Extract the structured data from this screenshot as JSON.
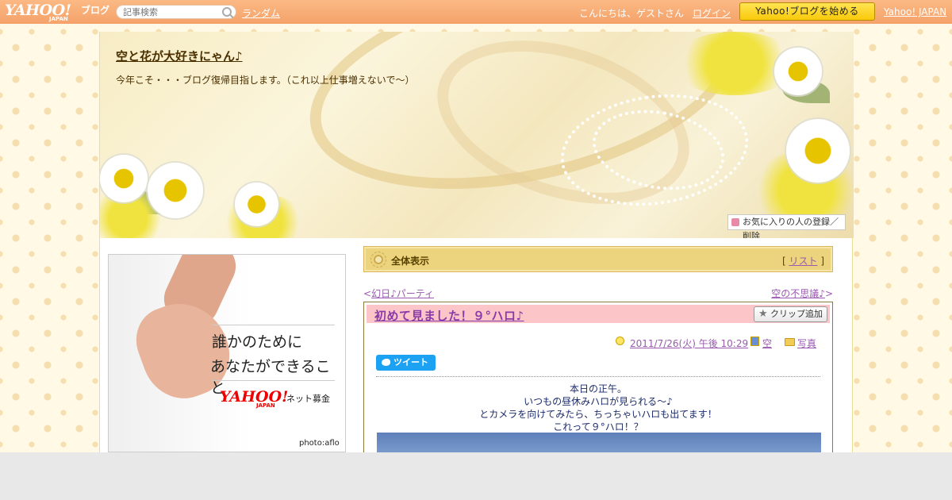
{
  "topbar": {
    "logo": "YAHOO!",
    "logo_sub": "JAPAN",
    "logo_blog": "ブログ",
    "search_placeholder": "記事検索",
    "random_link": "ランダム",
    "greeting": "こんにちは、ゲストさん",
    "login_link": "ログイン",
    "start_button": "Yahoo!ブログを始める",
    "yahoo_japan_link": "Yahoo! JAPAN"
  },
  "blog": {
    "title": "空と花が大好きにゃん♪",
    "description": "今年こそ・・・ブログ復帰目指します。（これ以上仕事増えないで～）",
    "favorite_button": "お気に入りの人の登録／削除"
  },
  "ad": {
    "line1": "誰かのために",
    "line2": "あなたができること",
    "brand": "YAHOO!",
    "brand_sub": "JAPAN",
    "service": "ネット募金",
    "credit": "photo:aflo"
  },
  "category_bar": {
    "label": "全体表示",
    "list_open": "[",
    "list_link": "リスト",
    "list_close": "]"
  },
  "nav": {
    "prev_arrow": "<",
    "prev_link": "幻日♪パーティ",
    "next_link": "空の不思議♪",
    "next_arrow": ">"
  },
  "post": {
    "title": "初めて見ました！９°ハロ♪",
    "clip_button": "クリップ追加",
    "date": "2011/7/26(火) 午後 10:29",
    "theme": "空",
    "category": "写真",
    "tweet_button": "ツイート",
    "body_lines": [
      "本日の正午。",
      "いつもの昼休みハロが見られる～♪",
      "とカメラを向けてみたら、ちっちゃいハロも出てます！",
      "これって９°ハロ！？"
    ]
  }
}
